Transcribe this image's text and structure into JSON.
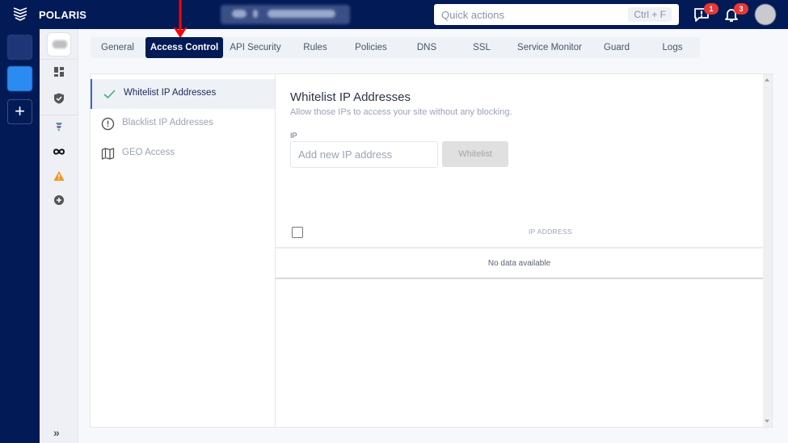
{
  "app": {
    "brand": "POLARIS",
    "quick_actions": {
      "placeholder": "Quick actions",
      "shortcut": "Ctrl + F"
    },
    "notifications": {
      "messages_count": "1",
      "alerts_count": "3"
    }
  },
  "rail": {
    "add_label": "+"
  },
  "sidebar": {
    "icons": [
      "dashboard-icon",
      "shield-check-icon",
      "waf-logo-icon",
      "infinity-icon",
      "warning-icon",
      "add-circle-icon"
    ],
    "collapse_label": "»"
  },
  "tabs": [
    {
      "label": "General",
      "active": false
    },
    {
      "label": "Access Control",
      "active": true
    },
    {
      "label": "API Security",
      "active": false
    },
    {
      "label": "Rules",
      "active": false
    },
    {
      "label": "Policies",
      "active": false
    },
    {
      "label": "DNS",
      "active": false
    },
    {
      "label": "SSL",
      "active": false
    },
    {
      "label": "Service Monitor",
      "active": false
    },
    {
      "label": "Guard",
      "active": false
    },
    {
      "label": "Logs",
      "active": false
    }
  ],
  "submenu": [
    {
      "label": "Whitelist IP Addresses",
      "icon": "check-icon",
      "active": true
    },
    {
      "label": "Blacklist IP Addresses",
      "icon": "alert-circle-icon",
      "active": false
    },
    {
      "label": "GEO Access",
      "icon": "map-icon",
      "active": false
    }
  ],
  "main": {
    "title": "Whitelist IP Addresses",
    "subtitle": "Allow those IPs to access your site without any blocking.",
    "ip_label": "IP",
    "ip_placeholder": "Add new IP address",
    "ip_value": "",
    "submit_label": "Whitelist",
    "table": {
      "columns": [
        "IP ADDRESS"
      ],
      "rows": [],
      "empty_text": "No data available"
    }
  },
  "colors": {
    "navy": "#021a56",
    "accent_blue": "#2c8bf0",
    "badge_red": "#e53935",
    "warning_orange": "#f7931e",
    "annotation_red": "#ff0000"
  }
}
